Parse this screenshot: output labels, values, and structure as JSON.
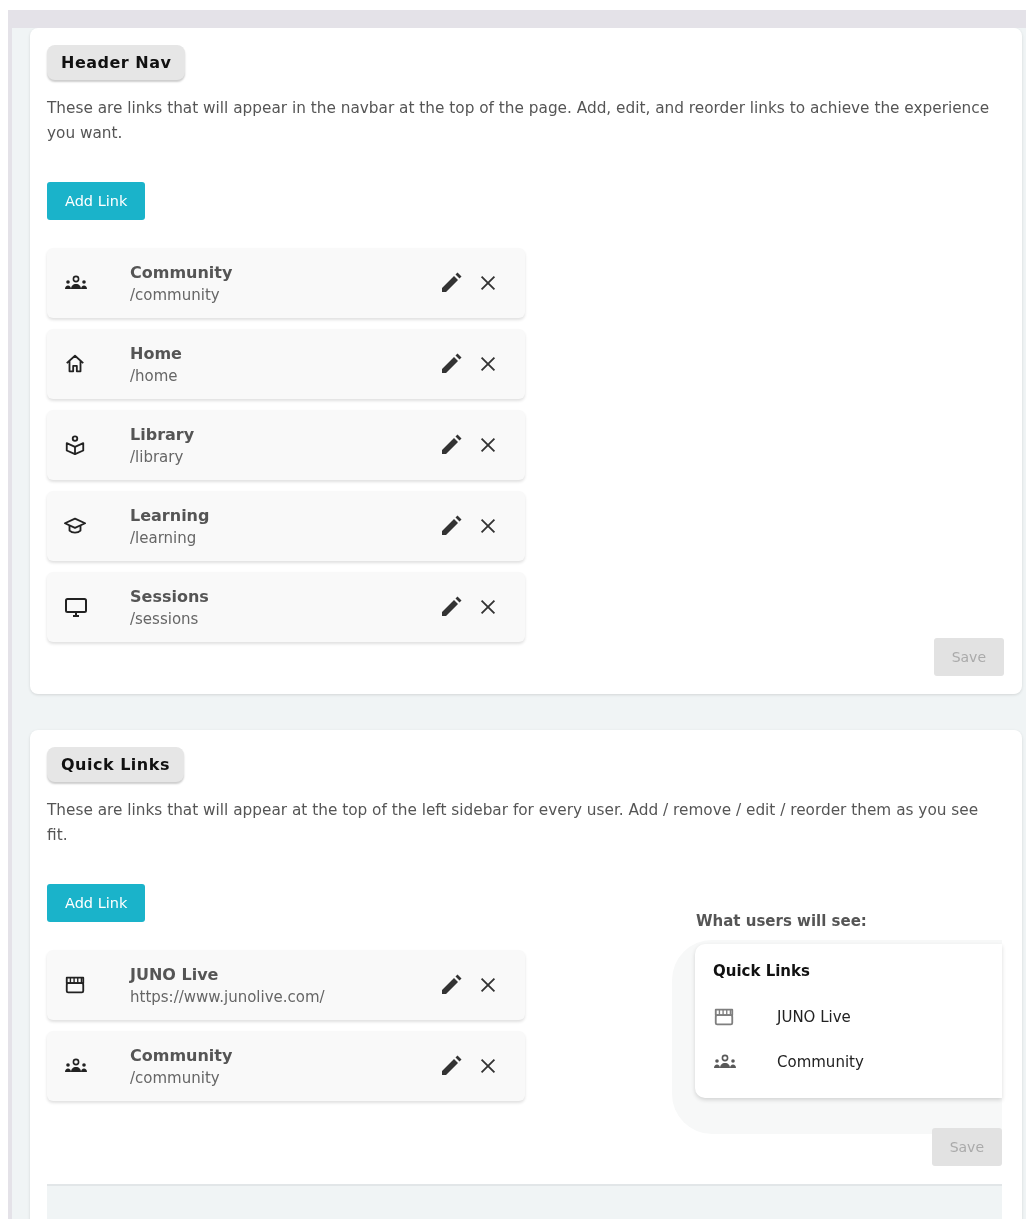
{
  "sections": [
    {
      "title": "Header Nav",
      "description": "These are links that will appear in the navbar at the top of the page. Add, edit, and reorder links to achieve the experience you want.",
      "add_button": "Add Link",
      "links": [
        {
          "kind": "people",
          "name": "Community",
          "path": "/community"
        },
        {
          "kind": "home",
          "name": "Home",
          "path": "/home"
        },
        {
          "kind": "library",
          "name": "Library",
          "path": "/library"
        },
        {
          "kind": "learning",
          "name": "Learning",
          "path": "/learning"
        },
        {
          "kind": "monitor",
          "name": "Sessions",
          "path": "/sessions"
        }
      ],
      "save_button": {
        "label": "Save",
        "disabled": true
      }
    },
    {
      "title": "Quick Links",
      "description": "These are links that will appear at the top of the left sidebar for every user. Add / remove / edit / reorder them as you see fit.",
      "add_button": "Add Link",
      "links": [
        {
          "kind": "store",
          "name": "JUNO Live",
          "path": "https://www.junolive.com/"
        },
        {
          "kind": "people",
          "name": "Community",
          "path": "/community"
        }
      ],
      "preview": {
        "label": "What users will see:",
        "title": "Quick Links",
        "items": [
          {
            "kind": "store",
            "name": "JUNO Live"
          },
          {
            "kind": "people",
            "name": "Community"
          }
        ]
      },
      "save_button": {
        "label": "Save",
        "disabled": true
      }
    }
  ]
}
